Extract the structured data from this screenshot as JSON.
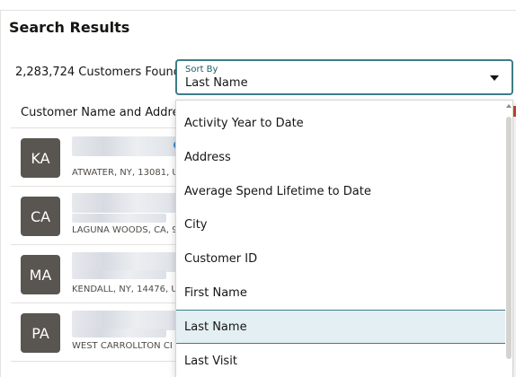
{
  "page": {
    "title": "Search Results",
    "results_count": "2,283,724 Customers Found"
  },
  "sort": {
    "label": "Sort By",
    "selected": "Last Name",
    "options": [
      "Activity Year to Date",
      "Address",
      "Average Spend Lifetime to Date",
      "City",
      "Customer ID",
      "First Name",
      "Last Name",
      "Last Visit"
    ]
  },
  "table": {
    "column_header": "Customer Name and Address",
    "rows": [
      {
        "initials": "KA",
        "address": "ATWATER, NY, 13081, U"
      },
      {
        "initials": "CA",
        "address": "LAGUNA WOODS, CA, 9"
      },
      {
        "initials": "MA",
        "address": "KENDALL, NY, 14476, U"
      },
      {
        "initials": "PA",
        "address": "WEST CARROLLTON CI"
      }
    ]
  },
  "colors": {
    "accent": "#3e7c88",
    "avatar_bg": "#595550",
    "selected_option_bg": "#e4eff3"
  }
}
